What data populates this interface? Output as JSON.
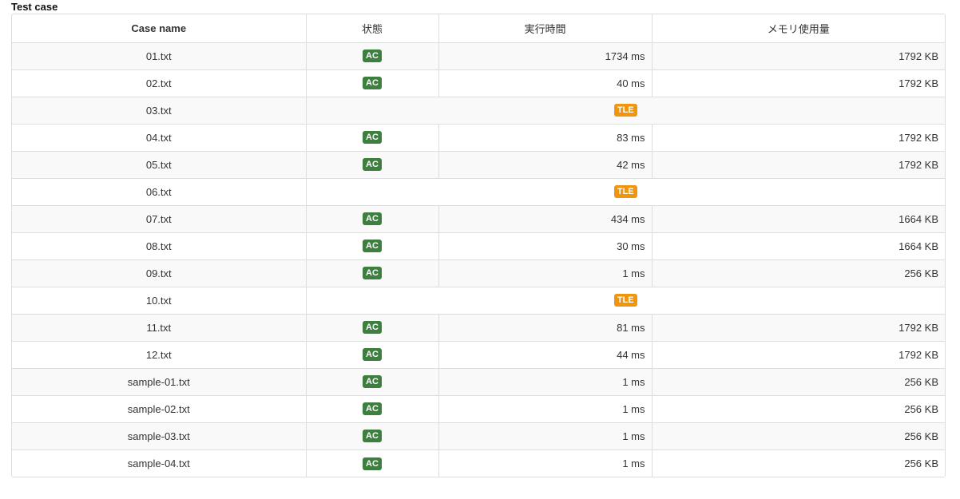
{
  "section": {
    "title": "Test case"
  },
  "table": {
    "headers": {
      "name": "Case name",
      "status": "状態",
      "time": "実行時間",
      "memory": "メモリ使用量"
    },
    "rows": [
      {
        "name": "01.txt",
        "status": "AC",
        "time": "1734 ms",
        "memory": "1792 KB"
      },
      {
        "name": "02.txt",
        "status": "AC",
        "time": "40 ms",
        "memory": "1792 KB"
      },
      {
        "name": "03.txt",
        "status": "TLE"
      },
      {
        "name": "04.txt",
        "status": "AC",
        "time": "83 ms",
        "memory": "1792 KB"
      },
      {
        "name": "05.txt",
        "status": "AC",
        "time": "42 ms",
        "memory": "1792 KB"
      },
      {
        "name": "06.txt",
        "status": "TLE"
      },
      {
        "name": "07.txt",
        "status": "AC",
        "time": "434 ms",
        "memory": "1664 KB"
      },
      {
        "name": "08.txt",
        "status": "AC",
        "time": "30 ms",
        "memory": "1664 KB"
      },
      {
        "name": "09.txt",
        "status": "AC",
        "time": "1 ms",
        "memory": "256 KB"
      },
      {
        "name": "10.txt",
        "status": "TLE"
      },
      {
        "name": "11.txt",
        "status": "AC",
        "time": "81 ms",
        "memory": "1792 KB"
      },
      {
        "name": "12.txt",
        "status": "AC",
        "time": "44 ms",
        "memory": "1792 KB"
      },
      {
        "name": "sample-01.txt",
        "status": "AC",
        "time": "1 ms",
        "memory": "256 KB"
      },
      {
        "name": "sample-02.txt",
        "status": "AC",
        "time": "1 ms",
        "memory": "256 KB"
      },
      {
        "name": "sample-03.txt",
        "status": "AC",
        "time": "1 ms",
        "memory": "256 KB"
      },
      {
        "name": "sample-04.txt",
        "status": "AC",
        "time": "1 ms",
        "memory": "256 KB"
      }
    ]
  },
  "colors": {
    "ac_badge": "#3c7f3f",
    "tle_badge": "#f0960e",
    "stripe": "#f9f9f9",
    "border": "#dddddd"
  }
}
